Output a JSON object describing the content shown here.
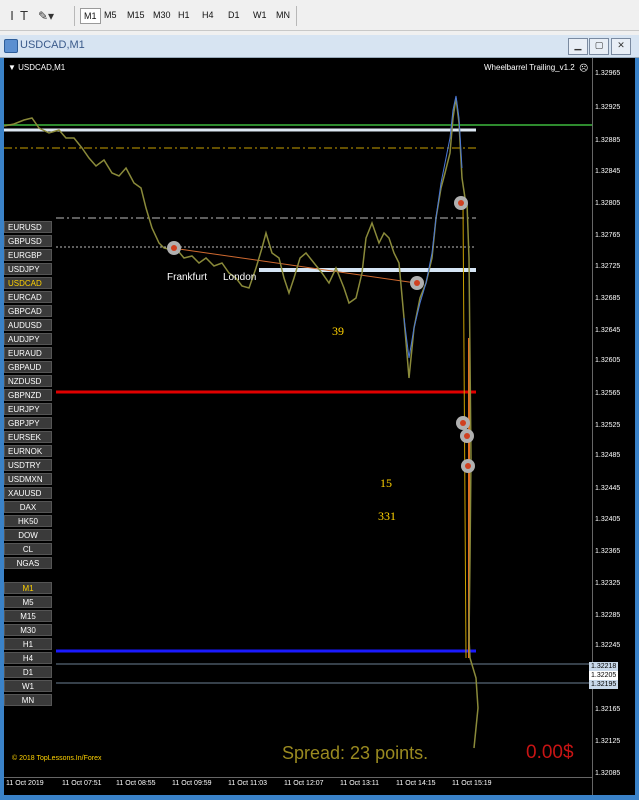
{
  "toolbar": {
    "timeframes": [
      "M1",
      "M5",
      "M15",
      "M30",
      "H1",
      "H4",
      "D1",
      "W1",
      "MN"
    ],
    "active_timeframe": "M1"
  },
  "window": {
    "title": "USDCAD,M1"
  },
  "chart": {
    "symbol_header": "USDCAD,M1",
    "indicator_name": "Wheelbarrel Trailing_v1.2",
    "price_levels": [
      "1.32965",
      "1.32925",
      "1.32885",
      "1.32845",
      "1.32805",
      "1.32765",
      "1.32725",
      "1.32685",
      "1.32645",
      "1.32605",
      "1.32565",
      "1.32525",
      "1.32485",
      "1.32445",
      "1.32405",
      "1.32365",
      "1.32325",
      "1.32285",
      "1.32245",
      "1.32165",
      "1.32125",
      "1.32085"
    ],
    "price_tags": {
      "upper": "1.32218",
      "middle": "1.32205",
      "lower": "1.32195"
    },
    "time_labels": [
      "11 Oct 2019",
      "11 Oct 07:51",
      "11 Oct 08:55",
      "11 Oct 09:59",
      "11 Oct 11:03",
      "11 Oct 12:07",
      "11 Oct 13:11",
      "11 Oct 14:15",
      "11 Oct 15:19"
    ],
    "session_labels": {
      "frankfurt": "Frankfurt",
      "london": "London"
    },
    "numbers": {
      "n39": "39",
      "n15": "15",
      "n331": "331"
    },
    "copyright": "© 2018 TopLessons.In/Forex",
    "spread": "Spread: 23 points.",
    "profit": "0.00$"
  },
  "symbols": [
    "EURUSD",
    "GBPUSD",
    "EURGBP",
    "USDJPY",
    "USDCAD",
    "EURCAD",
    "GBPCAD",
    "AUDUSD",
    "AUDJPY",
    "EURAUD",
    "GBPAUD",
    "NZDUSD",
    "GBPNZD",
    "EURJPY",
    "GBPJPY",
    "EURSEK",
    "EURNOK",
    "USDTRY",
    "USDMXN",
    "XAUUSD",
    "DAX",
    "HK50",
    "DOW",
    "CL",
    "NGAS"
  ],
  "active_symbol": "USDCAD",
  "timeframe_buttons": [
    "M1",
    "M5",
    "M15",
    "M30",
    "H1",
    "H4",
    "D1",
    "W1",
    "MN"
  ],
  "colors": {
    "green_line": "#2e8b2e",
    "red_line": "#e00000",
    "blue_line": "#1a1aff",
    "white_line": "#dde8f2",
    "gold": "#ffd200",
    "profit_red": "#c81414",
    "spread_olive": "#9a8a20"
  }
}
